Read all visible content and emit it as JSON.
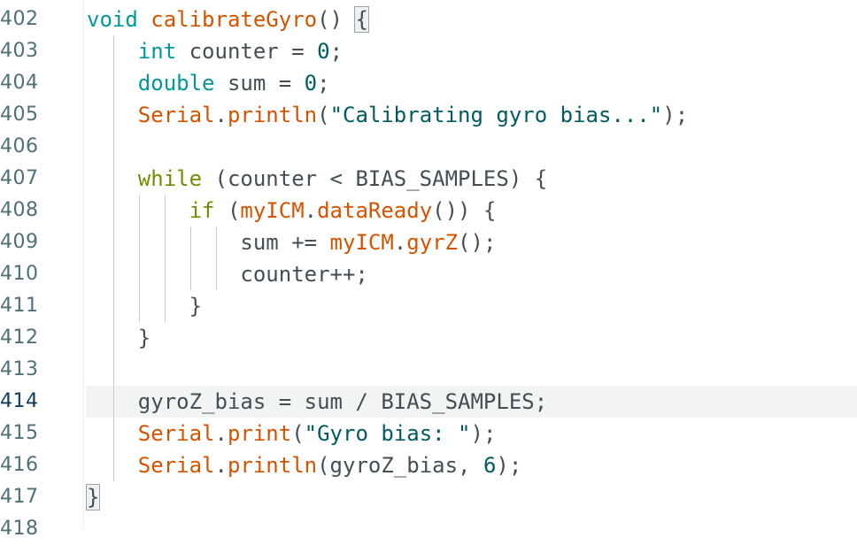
{
  "editor": {
    "colors": {
      "type": "#00979d",
      "keyword": "#728e00",
      "function": "#d35400",
      "string": "#005c5f",
      "text": "#434f54",
      "line_number": "#4f6f79",
      "current_line_bg": "#f2f3f3"
    },
    "current_line": "414",
    "lines": [
      {
        "number": "402",
        "tokens": [
          {
            "text": "void",
            "cls": "type"
          },
          {
            "text": " "
          },
          {
            "text": "calibrateGyro",
            "cls": "fn"
          },
          {
            "text": "() "
          },
          {
            "text": "{",
            "cls": "brace"
          }
        ]
      },
      {
        "number": "403",
        "tokens": [
          {
            "text": "    "
          },
          {
            "text": "int",
            "cls": "type"
          },
          {
            "text": " counter = "
          },
          {
            "text": "0",
            "cls": "num"
          },
          {
            "text": ";"
          }
        ]
      },
      {
        "number": "404",
        "tokens": [
          {
            "text": "    "
          },
          {
            "text": "double",
            "cls": "type"
          },
          {
            "text": " sum = "
          },
          {
            "text": "0",
            "cls": "num"
          },
          {
            "text": ";"
          }
        ]
      },
      {
        "number": "405",
        "tokens": [
          {
            "text": "    "
          },
          {
            "text": "Serial",
            "cls": "fn"
          },
          {
            "text": "."
          },
          {
            "text": "println",
            "cls": "fn"
          },
          {
            "text": "("
          },
          {
            "text": "\"Calibrating gyro bias...\"",
            "cls": "str"
          },
          {
            "text": ");"
          }
        ]
      },
      {
        "number": "406",
        "tokens": []
      },
      {
        "number": "407",
        "tokens": [
          {
            "text": "    "
          },
          {
            "text": "while",
            "cls": "kw"
          },
          {
            "text": " (counter < BIAS_SAMPLES) {"
          }
        ]
      },
      {
        "number": "408",
        "tokens": [
          {
            "text": "        "
          },
          {
            "text": "if",
            "cls": "kw"
          },
          {
            "text": " ("
          },
          {
            "text": "myICM",
            "cls": "fn"
          },
          {
            "text": "."
          },
          {
            "text": "dataReady",
            "cls": "fn"
          },
          {
            "text": "()) {"
          }
        ]
      },
      {
        "number": "409",
        "tokens": [
          {
            "text": "            sum += "
          },
          {
            "text": "myICM",
            "cls": "fn"
          },
          {
            "text": "."
          },
          {
            "text": "gyrZ",
            "cls": "fn"
          },
          {
            "text": "();"
          }
        ]
      },
      {
        "number": "410",
        "tokens": [
          {
            "text": "            counter++;"
          }
        ]
      },
      {
        "number": "411",
        "tokens": [
          {
            "text": "        }"
          }
        ]
      },
      {
        "number": "412",
        "tokens": [
          {
            "text": "    }"
          }
        ]
      },
      {
        "number": "413",
        "tokens": []
      },
      {
        "number": "414",
        "tokens": [
          {
            "text": "    gyroZ_bias = sum / BIAS_SAMPLES;"
          }
        ]
      },
      {
        "number": "415",
        "tokens": [
          {
            "text": "    "
          },
          {
            "text": "Serial",
            "cls": "fn"
          },
          {
            "text": "."
          },
          {
            "text": "print",
            "cls": "fn"
          },
          {
            "text": "("
          },
          {
            "text": "\"Gyro bias: \"",
            "cls": "str"
          },
          {
            "text": ");"
          }
        ]
      },
      {
        "number": "416",
        "tokens": [
          {
            "text": "    "
          },
          {
            "text": "Serial",
            "cls": "fn"
          },
          {
            "text": "."
          },
          {
            "text": "println",
            "cls": "fn"
          },
          {
            "text": "(gyroZ_bias, "
          },
          {
            "text": "6",
            "cls": "num"
          },
          {
            "text": ");"
          }
        ]
      },
      {
        "number": "417",
        "tokens": [
          {
            "text": "}",
            "cls": "brace"
          }
        ]
      },
      {
        "number": "418",
        "tokens": []
      }
    ]
  }
}
